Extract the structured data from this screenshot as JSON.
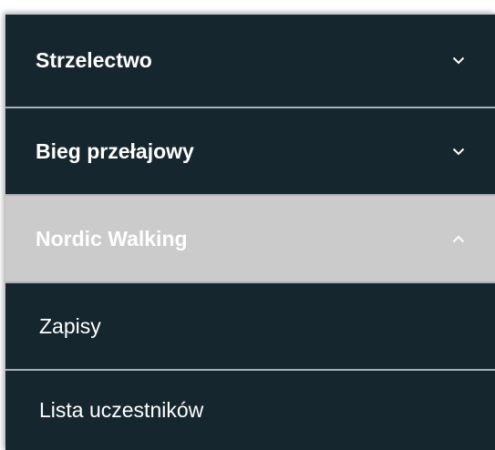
{
  "menu": {
    "items": [
      {
        "label": "Strzelectwo",
        "icon": "chevron-down-icon",
        "expanded": false
      },
      {
        "label": "Bieg przełajowy",
        "icon": "chevron-down-icon",
        "expanded": false
      },
      {
        "label": "Nordic Walking",
        "icon": "chevron-up-icon",
        "expanded": true,
        "children": [
          {
            "label": "Zapisy"
          },
          {
            "label": "Lista uczestników"
          }
        ]
      }
    ]
  },
  "colors": {
    "menu_background": "#16262e",
    "active_background": "#cbcbcb",
    "divider": "#a9b1b6",
    "text": "#ffffff"
  }
}
